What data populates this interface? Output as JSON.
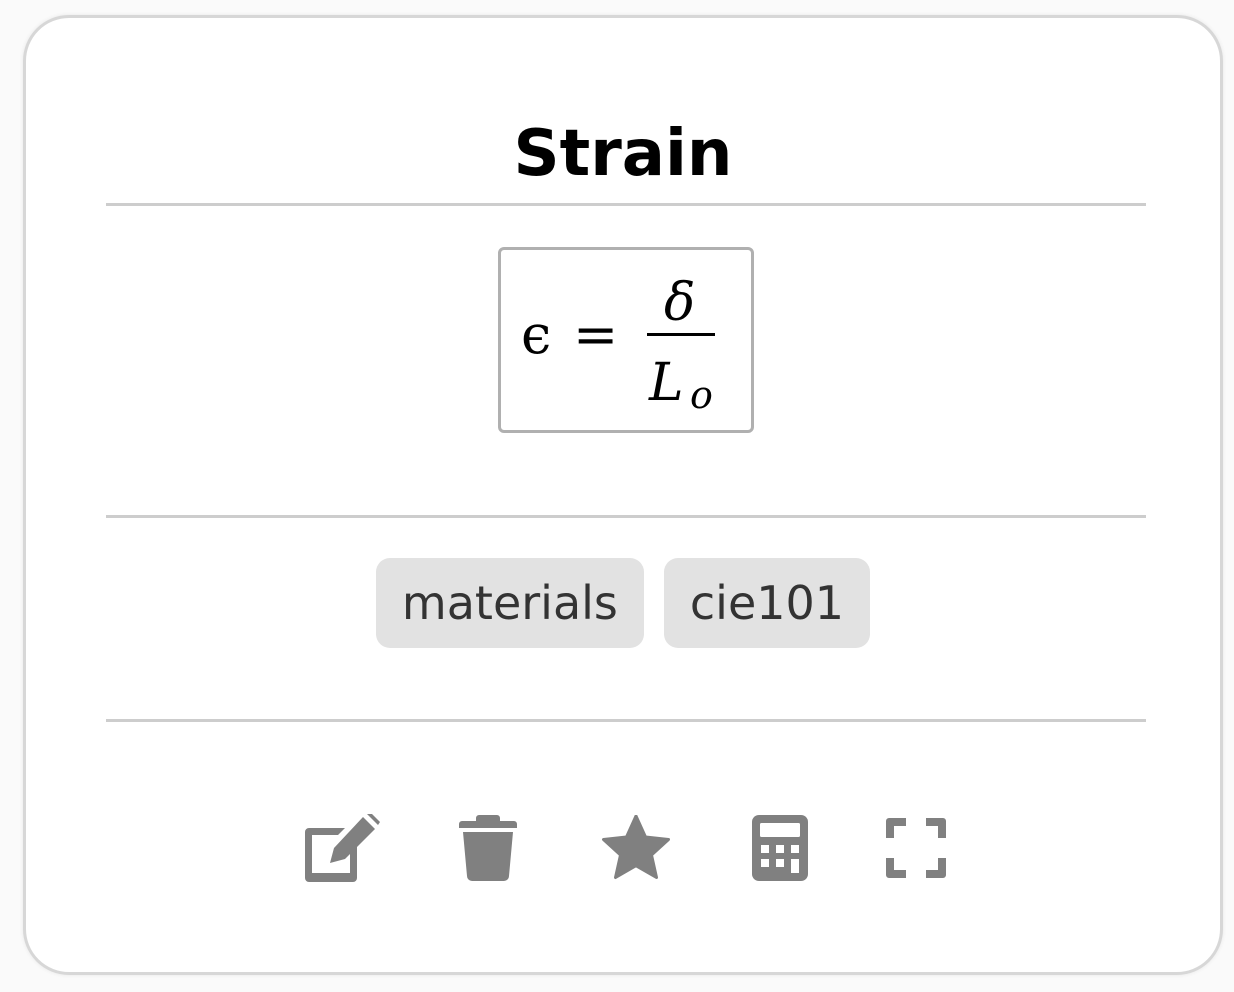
{
  "card": {
    "title": "Strain",
    "formula": {
      "lhs": "ϵ",
      "equals": "=",
      "numerator": "δ",
      "denominator_main": "L",
      "denominator_sub": "o"
    },
    "tags": [
      {
        "label": "materials"
      },
      {
        "label": "cie101"
      }
    ],
    "actions": [
      {
        "icon": "edit-icon"
      },
      {
        "icon": "trash-icon"
      },
      {
        "icon": "star-icon"
      },
      {
        "icon": "calculator-icon"
      },
      {
        "icon": "expand-icon"
      }
    ]
  },
  "colors": {
    "icon": "#808080",
    "tag_bg": "#e2e2e2",
    "tag_text": "#333333",
    "divider": "#cdcdcd",
    "border": "#d7d7d7"
  }
}
